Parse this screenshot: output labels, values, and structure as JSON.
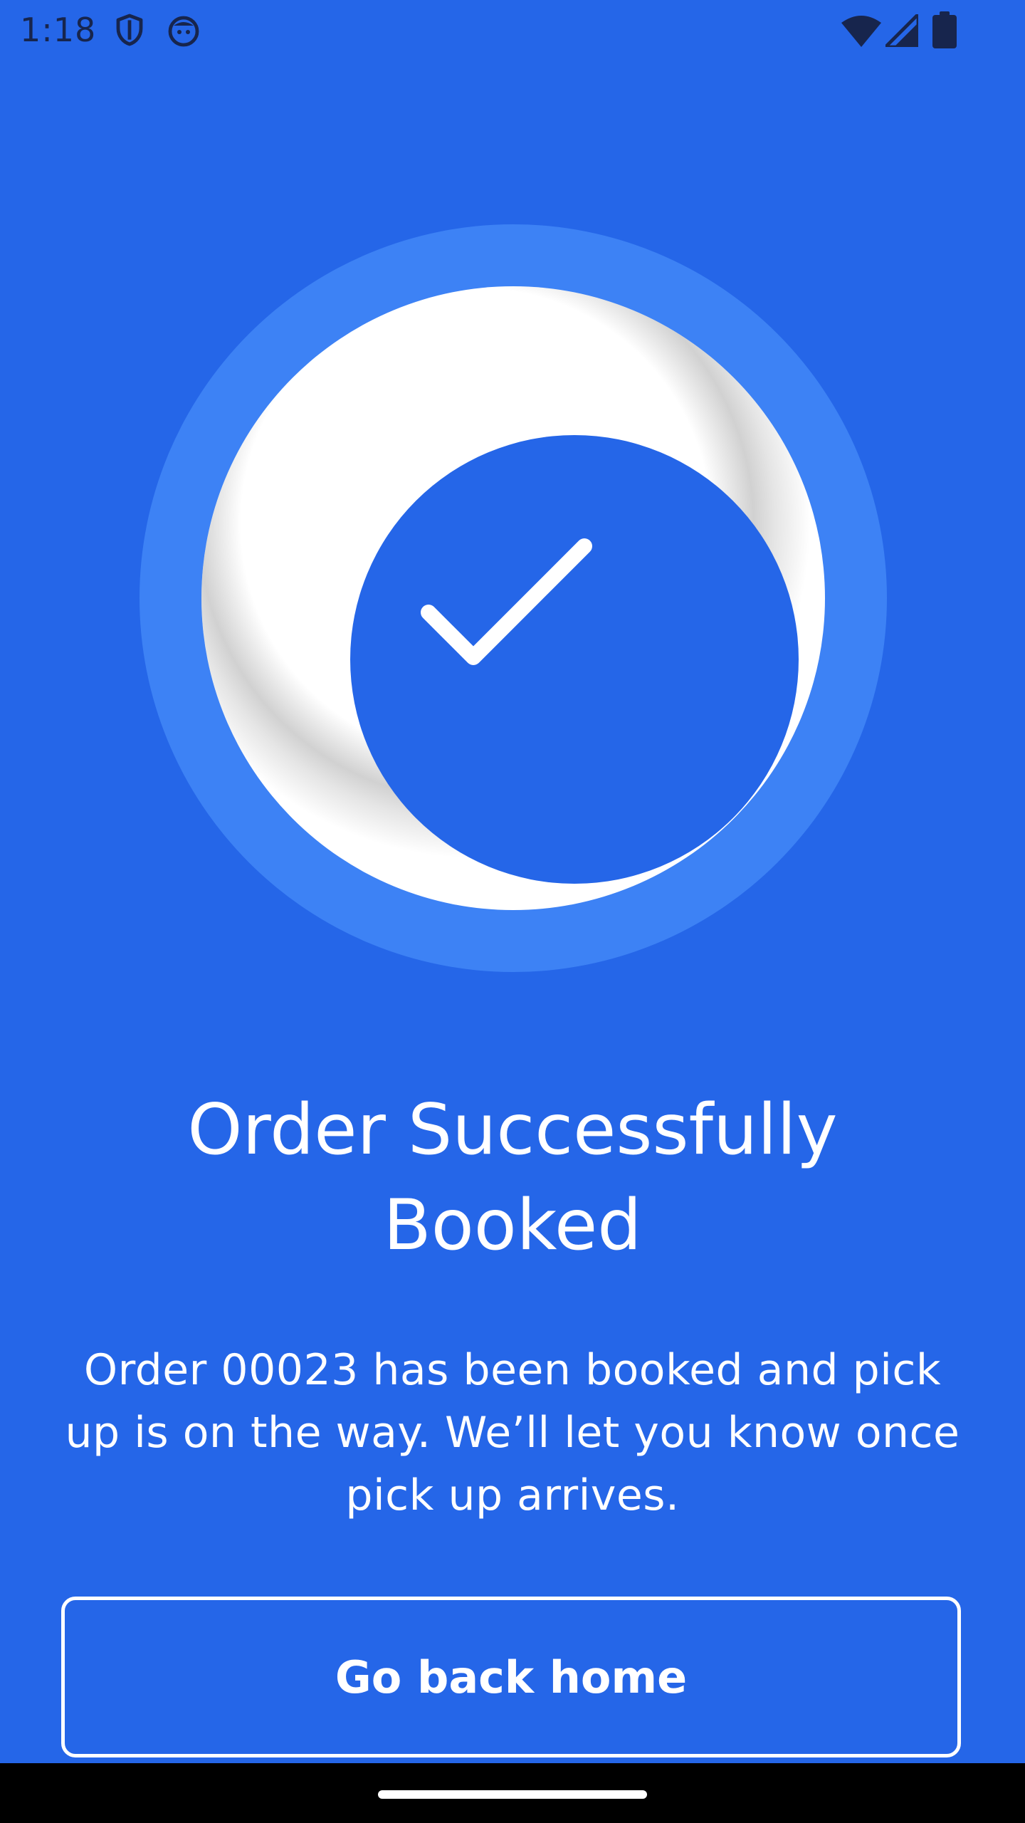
{
  "status_bar": {
    "time": "1:18",
    "left_icons": [
      "shield-icon",
      "bot-icon"
    ],
    "right_icons": [
      "wifi-icon",
      "cell-signal-icon",
      "battery-icon"
    ]
  },
  "hero": {
    "icon": "check-icon"
  },
  "title": "Order Successfully Booked",
  "message": "Order 00023 has been booked and pick up is on the way. We’ll let you know once pick up arrives.",
  "button": {
    "label": "Go back home"
  },
  "colors": {
    "background": "#2566E8",
    "outer_ring": "#3D82F5",
    "white": "#FFFFFF",
    "status_icons": "#17254D"
  }
}
